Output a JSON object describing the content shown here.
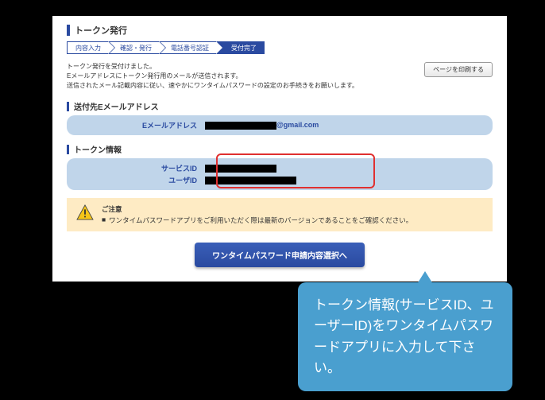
{
  "page_title": "トークン発行",
  "steps": {
    "s1": "内容入力",
    "s2": "確認・発行",
    "s3": "電話番号認証",
    "s4": "受付完了"
  },
  "desc_lines": {
    "l1": "トークン発行を受付けました。",
    "l2": "Eメールアドレスにトークン発行用のメールが送信されます。",
    "l3": "送信されたメール記載内容に従い、速やかにワンタイムパスワードの設定のお手続きをお願いします。"
  },
  "print_btn": "ページを印刷する",
  "email_section_title": "送付先Eメールアドレス",
  "email_label": "Eメールアドレス",
  "email_suffix": "@gmail.com",
  "token_section_title": "トークン情報",
  "service_id_label": "サービスID",
  "user_id_label": "ユーザID",
  "warn_title": "ご注意",
  "warn_bullet_mark": "■",
  "warn_line": "ワンタイムパスワードアプリをご利用いただく際は最新のバージョンであることをご確認ください。",
  "action_btn": "ワンタイムパスワード申請内容選択へ",
  "callout": "トークン情報(サービスID、ユーザーID)をワンタイムパスワードアプリに入力して下さい。"
}
